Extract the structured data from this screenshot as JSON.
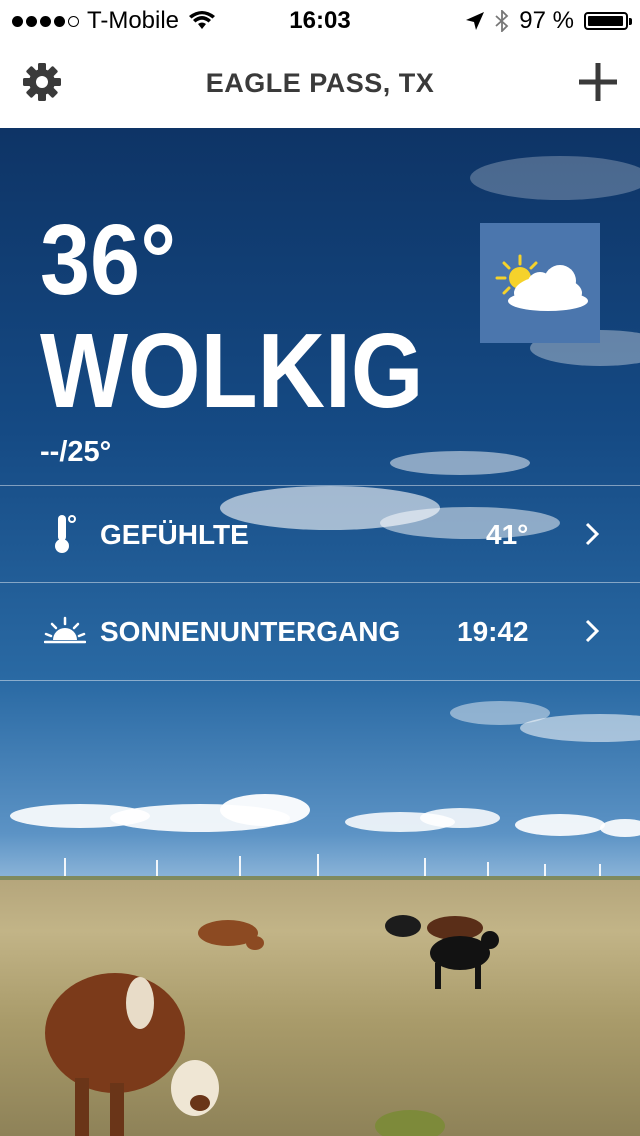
{
  "status_bar": {
    "carrier": "T-Mobile",
    "signal_dots_filled": 4,
    "signal_dots_total": 5,
    "time": "16:03",
    "battery_text": "97 %",
    "battery_level": 0.97
  },
  "nav": {
    "title": "EAGLE PASS, TX",
    "settings_icon": "gear-icon",
    "add_icon": "plus-icon"
  },
  "weather": {
    "temperature": "36°",
    "condition": "WOLKIG",
    "min_max": "--/25°",
    "condition_icon": "partly-cloudy-icon"
  },
  "details": [
    {
      "icon": "thermometer-icon",
      "label": "GEFÜHLTE",
      "value": "41°"
    },
    {
      "icon": "sunset-icon",
      "label": "SONNENUNTERGANG",
      "value": "19:42"
    }
  ],
  "colors": {
    "bar_background": "#ffffff",
    "title_text": "#3a3a3a",
    "condition_tile": "#4b76ad",
    "sun": "#f5d22b"
  }
}
